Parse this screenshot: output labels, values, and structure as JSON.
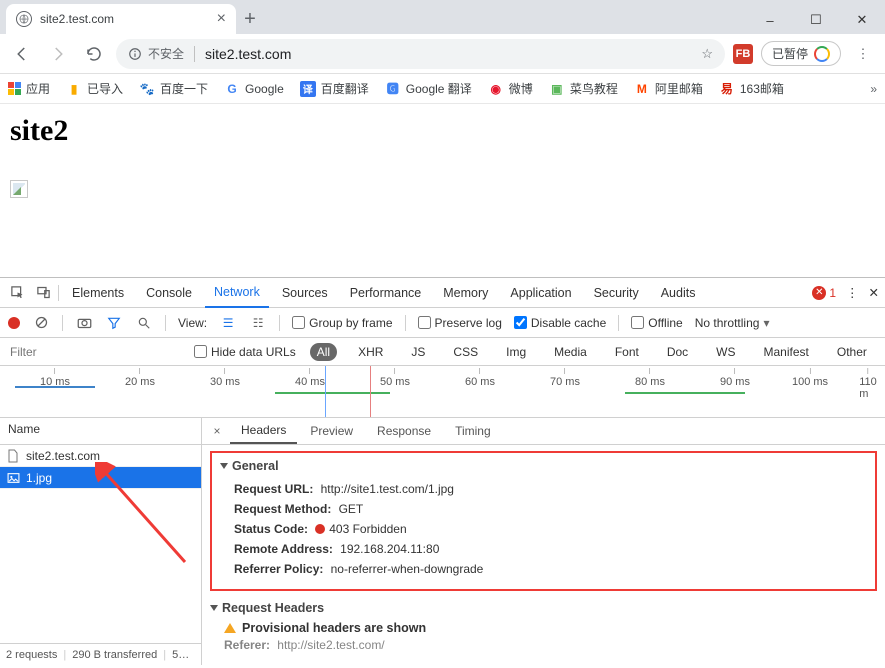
{
  "window": {
    "tab_title": "site2.test.com",
    "new_tab_glyph": "+",
    "minimize": "–",
    "maximize": "☐",
    "close": "✕"
  },
  "nav": {
    "security_text": "不安全",
    "url": "site2.test.com",
    "pause_label": "已暂停"
  },
  "bookmarks": {
    "apps": "应用",
    "items": [
      "已导入",
      "百度一下",
      "Google",
      "百度翻译",
      "Google 翻译",
      "微博",
      "菜鸟教程",
      "阿里邮箱",
      "163邮箱"
    ]
  },
  "page": {
    "heading": "site2"
  },
  "devtools": {
    "tabs": [
      "Elements",
      "Console",
      "Network",
      "Sources",
      "Performance",
      "Memory",
      "Application",
      "Security",
      "Audits"
    ],
    "active_tab": "Network",
    "error_count": "1",
    "toolbar": {
      "view_label": "View:",
      "group_by_frame": "Group by frame",
      "preserve_log": "Preserve log",
      "disable_cache": "Disable cache",
      "offline": "Offline",
      "throttling": "No throttling"
    },
    "filter": {
      "placeholder": "Filter",
      "hide_data_urls": "Hide data URLs",
      "types": [
        "All",
        "XHR",
        "JS",
        "CSS",
        "Img",
        "Media",
        "Font",
        "Doc",
        "WS",
        "Manifest",
        "Other"
      ],
      "active_type": "All"
    },
    "timeline_ticks": [
      "10 ms",
      "20 ms",
      "30 ms",
      "40 ms",
      "50 ms",
      "60 ms",
      "70 ms",
      "80 ms",
      "90 ms",
      "100 ms",
      "110 m"
    ],
    "requests": {
      "column_header": "Name",
      "rows": [
        "site2.test.com",
        "1.jpg"
      ],
      "selected": "1.jpg",
      "status_bar": {
        "count": "2 requests",
        "size": "290 B transferred",
        "rest": "5…"
      }
    },
    "detail": {
      "tabs": [
        "Headers",
        "Preview",
        "Response",
        "Timing"
      ],
      "active_tab": "Headers",
      "general_title": "General",
      "general": {
        "request_url_label": "Request URL:",
        "request_url": "http://site1.test.com/1.jpg",
        "request_method_label": "Request Method:",
        "request_method": "GET",
        "status_code_label": "Status Code:",
        "status_code": "403 Forbidden",
        "remote_address_label": "Remote Address:",
        "remote_address": "192.168.204.11:80",
        "referrer_policy_label": "Referrer Policy:",
        "referrer_policy": "no-referrer-when-downgrade"
      },
      "request_headers_title": "Request Headers",
      "provisional_text": "Provisional headers are shown",
      "referer_label": "Referer:",
      "referer_value": "http://site2.test.com/"
    }
  }
}
